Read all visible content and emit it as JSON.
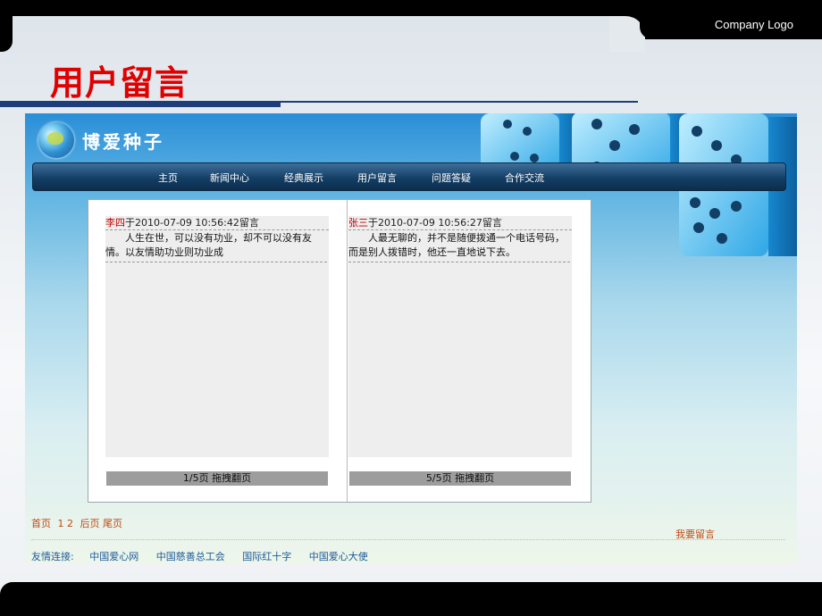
{
  "slide": {
    "company_logo": "Company Logo",
    "title": "用户留言"
  },
  "site": {
    "name": "博爱种子",
    "nav": [
      "主页",
      "新闻中心",
      "经典展示",
      "用户留言",
      "问题答疑",
      "合作交流"
    ]
  },
  "messages": {
    "left": {
      "author": "李四",
      "meta": "于2010-07-09 10:56:42留言",
      "body": "人生在世，可以没有功业，却不可以没有友情。以友情助功业则功业成",
      "pager": "1/5页  拖拽翻页"
    },
    "right": {
      "author": "张三",
      "meta": "于2010-07-09 10:56:27留言",
      "body": "人最无聊的，并不是随便拨通一个电话号码，而是别人拨错时，他还一直地说下去。",
      "pager": "5/5页  拖拽翻页"
    }
  },
  "pagination": {
    "first": "首页",
    "pages": "1 2",
    "last": "后页 尾页"
  },
  "leave_message": "我要留言",
  "friend_links": {
    "label": "友情连接:",
    "items": [
      "中国爱心网",
      "中国慈善总工会",
      "国际红十字",
      "中国爱心大使"
    ]
  },
  "colors": {
    "title_red": "#e00000",
    "nav_dark": "#143f66",
    "link_orange": "#c04a12",
    "link_blue": "#1b5a9a"
  }
}
